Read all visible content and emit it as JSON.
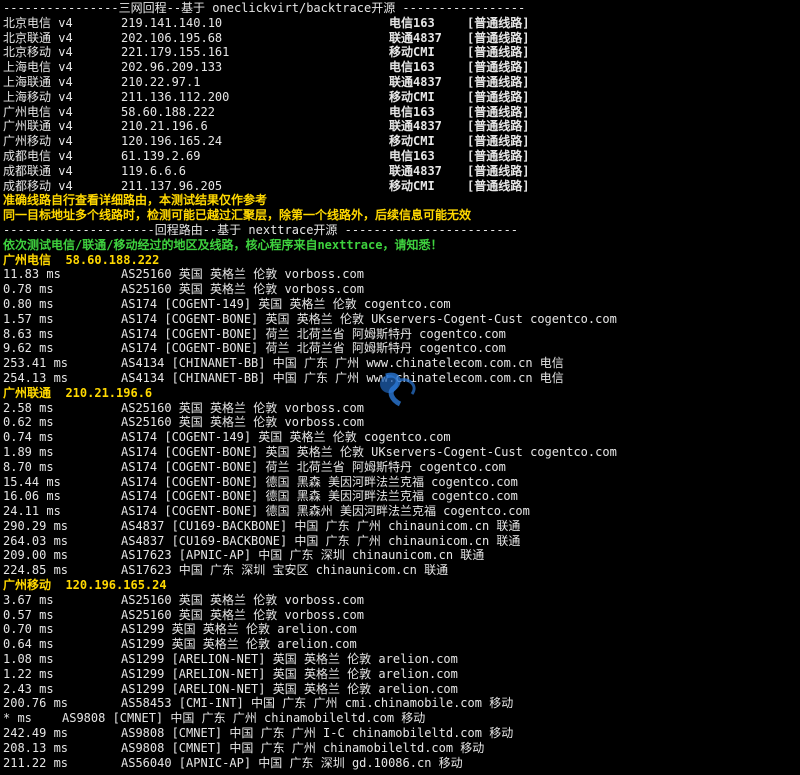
{
  "header_sep": "----------------三网回程--基于 oneclickvirt/backtrace开源 -----------------",
  "backtrace_rows": [
    {
      "loc": "北京电信 v4",
      "ip": "219.141.140.10",
      "carrier": "电信163",
      "route": "[普通线路]"
    },
    {
      "loc": "北京联通 v4",
      "ip": "202.106.195.68",
      "carrier": "联通4837",
      "route": "[普通线路]"
    },
    {
      "loc": "北京移动 v4",
      "ip": "221.179.155.161",
      "carrier": "移动CMI",
      "route": "[普通线路]"
    },
    {
      "loc": "上海电信 v4",
      "ip": "202.96.209.133",
      "carrier": "电信163",
      "route": "[普通线路]"
    },
    {
      "loc": "上海联通 v4",
      "ip": "210.22.97.1",
      "carrier": "联通4837",
      "route": "[普通线路]"
    },
    {
      "loc": "上海移动 v4",
      "ip": "211.136.112.200",
      "carrier": "移动CMI",
      "route": "[普通线路]"
    },
    {
      "loc": "广州电信 v4",
      "ip": "58.60.188.222",
      "carrier": "电信163",
      "route": "[普通线路]"
    },
    {
      "loc": "广州联通 v4",
      "ip": "210.21.196.6",
      "carrier": "联通4837",
      "route": "[普通线路]"
    },
    {
      "loc": "广州移动 v4",
      "ip": "120.196.165.24",
      "carrier": "移动CMI",
      "route": "[普通线路]"
    },
    {
      "loc": "成都电信 v4",
      "ip": "61.139.2.69",
      "carrier": "电信163",
      "route": "[普通线路]"
    },
    {
      "loc": "成都联通 v4",
      "ip": "119.6.6.6",
      "carrier": "联通4837",
      "route": "[普通线路]"
    },
    {
      "loc": "成都移动 v4",
      "ip": "211.137.96.205",
      "carrier": "移动CMI",
      "route": "[普通线路]"
    }
  ],
  "warning_1": "准确线路自行查看详细路由，本测试结果仅作参考",
  "warning_2": "同一目标地址多个线路时，检测可能已越过汇聚层，除第一个线路外，后续信息可能无效",
  "trace_sep": "---------------------回程路由--基于 nexttrace开源 ------------------------",
  "trace_note": "依次测试电信/联通/移动经过的地区及线路，核心程序来自nexttrace，请知悉！",
  "routes": [
    {
      "title": "广州电信  58.60.188.222",
      "hops": [
        {
          "rtt": "11.83 ms",
          "info": "AS25160 英国 英格兰 伦敦 vorboss.com"
        },
        {
          "rtt": "0.78 ms",
          "info": "AS25160 英国 英格兰 伦敦 vorboss.com"
        },
        {
          "rtt": "0.80 ms",
          "info": "AS174 [COGENT-149] 英国 英格兰 伦敦 cogentco.com"
        },
        {
          "rtt": "1.57 ms",
          "info": "AS174 [COGENT-BONE] 英国 英格兰 伦敦 UKservers-Cogent-Cust cogentco.com"
        },
        {
          "rtt": "8.63 ms",
          "info": "AS174 [COGENT-BONE] 荷兰 北荷兰省 阿姆斯特丹 cogentco.com"
        },
        {
          "rtt": "9.62 ms",
          "info": "AS174 [COGENT-BONE] 荷兰 北荷兰省 阿姆斯特丹 cogentco.com"
        },
        {
          "rtt": "253.41 ms",
          "info": "AS4134 [CHINANET-BB] 中国 广东 广州 www.chinatelecom.com.cn 电信"
        },
        {
          "rtt": "254.13 ms",
          "info": "AS4134 [CHINANET-BB] 中国 广东 广州 www.chinatelecom.com.cn 电信"
        }
      ]
    },
    {
      "title": "广州联通  210.21.196.6",
      "hops": [
        {
          "rtt": "2.58 ms",
          "info": "AS25160 英国 英格兰 伦敦 vorboss.com"
        },
        {
          "rtt": "0.62 ms",
          "info": "AS25160 英国 英格兰 伦敦 vorboss.com"
        },
        {
          "rtt": "0.74 ms",
          "info": "AS174 [COGENT-149] 英国 英格兰 伦敦 cogentco.com"
        },
        {
          "rtt": "1.89 ms",
          "info": "AS174 [COGENT-BONE] 英国 英格兰 伦敦 UKservers-Cogent-Cust cogentco.com"
        },
        {
          "rtt": "8.70 ms",
          "info": "AS174 [COGENT-BONE] 荷兰 北荷兰省 阿姆斯特丹 cogentco.com"
        },
        {
          "rtt": "15.44 ms",
          "info": "AS174 [COGENT-BONE] 德国 黑森 美因河畔法兰克福 cogentco.com"
        },
        {
          "rtt": "16.06 ms",
          "info": "AS174 [COGENT-BONE] 德国 黑森 美因河畔法兰克福 cogentco.com"
        },
        {
          "rtt": "24.11 ms",
          "info": "AS174 [COGENT-BONE] 德国 黑森州 美因河畔法兰克福 cogentco.com"
        },
        {
          "rtt": "290.29 ms",
          "info": "AS4837 [CU169-BACKBONE] 中国 广东 广州 chinaunicom.cn 联通"
        },
        {
          "rtt": "264.03 ms",
          "info": "AS4837 [CU169-BACKBONE] 中国 广东 广州 chinaunicom.cn 联通"
        },
        {
          "rtt": "209.00 ms",
          "info": "AS17623 [APNIC-AP] 中国 广东 深圳 chinaunicom.cn 联通"
        },
        {
          "rtt": "224.85 ms",
          "info": "AS17623 中国 广东 深圳 宝安区 chinaunicom.cn 联通"
        }
      ]
    },
    {
      "title": "广州移动  120.196.165.24",
      "hops": [
        {
          "rtt": "3.67 ms",
          "info": "AS25160 英国 英格兰 伦敦 vorboss.com"
        },
        {
          "rtt": "0.57 ms",
          "info": "AS25160 英国 英格兰 伦敦 vorboss.com"
        },
        {
          "rtt": "0.70 ms",
          "info": "AS1299 英国 英格兰 伦敦 arelion.com"
        },
        {
          "rtt": "0.64 ms",
          "info": "AS1299 英国 英格兰 伦敦 arelion.com"
        },
        {
          "rtt": "1.08 ms",
          "info": "AS1299 [ARELION-NET] 英国 英格兰 伦敦 arelion.com"
        },
        {
          "rtt": "1.22 ms",
          "info": "AS1299 [ARELION-NET] 英国 英格兰 伦敦 arelion.com"
        },
        {
          "rtt": "2.43 ms",
          "info": "AS1299 [ARELION-NET] 英国 英格兰 伦敦 arelion.com"
        },
        {
          "rtt": "200.76 ms",
          "info": "AS58453 [CMI-INT] 中国 广东 广州 cmi.chinamobile.com 移动"
        },
        {
          "rtt": "* ms",
          "info": "AS9808 [CMNET] 中国 广东 广州 chinamobileltd.com 移动",
          "short": true
        },
        {
          "rtt": "242.49 ms",
          "info": "AS9808 [CMNET] 中国 广东 广州 I-C chinamobileltd.com 移动"
        },
        {
          "rtt": "208.13 ms",
          "info": "AS9808 [CMNET] 中国 广东 广州 chinamobileltd.com 移动"
        },
        {
          "rtt": "211.22 ms",
          "info": "AS56040 [APNIC-AP] 中国 广东 深圳 gd.10086.cn 移动"
        }
      ]
    }
  ]
}
